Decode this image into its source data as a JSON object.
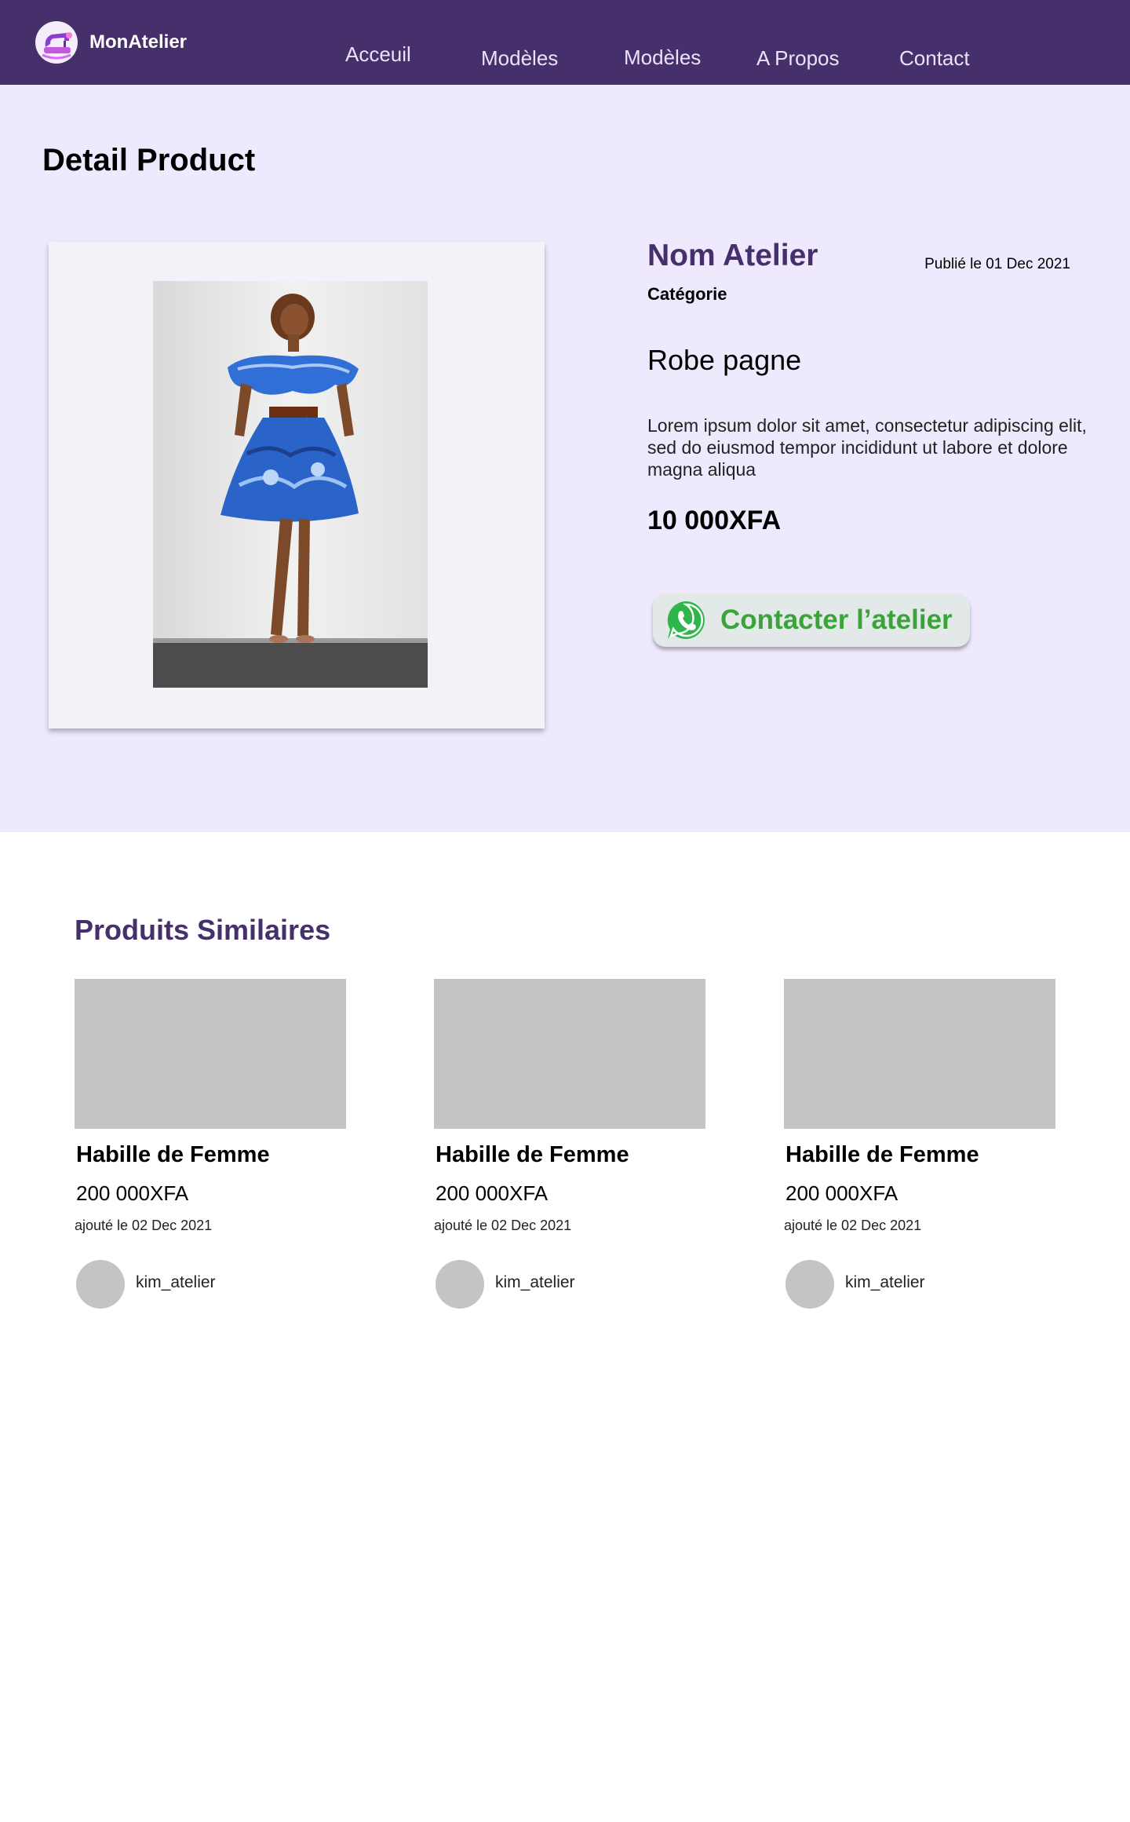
{
  "brand": {
    "name": "MonAtelier",
    "accent": "#45306b",
    "logo_icon": "sewing-machine-icon"
  },
  "nav": {
    "items": [
      {
        "label": "Acceuil"
      },
      {
        "label": "Modèles"
      },
      {
        "label": "Modèles"
      },
      {
        "label": "A Propos"
      },
      {
        "label": "Contact"
      }
    ]
  },
  "detail": {
    "page_title": "Detail Product",
    "atelier_name": "Nom Atelier",
    "published": "Publié le 01 Dec 2021",
    "category": "Catégorie",
    "product_name": "Robe pagne",
    "description": "Lorem ipsum dolor sit amet, consectetur adipiscing elit, sed do eiusmod tempor incididunt ut labore et dolore magna aliqua",
    "price": "10 000XFA",
    "contact_button": {
      "label": "Contacter l’atelier",
      "icon": "whatsapp-icon",
      "color": "#3aa43a"
    }
  },
  "similar": {
    "title": "Produits Similaires",
    "products": [
      {
        "title": "Habille de Femme",
        "price": "200 000XFA",
        "date": "ajouté le 02 Dec 2021",
        "user": "kim_atelier"
      },
      {
        "title": "Habille de Femme",
        "price": "200 000XFA",
        "date": "ajouté le 02 Dec 2021",
        "user": "kim_atelier"
      },
      {
        "title": "Habille de Femme",
        "price": "200 000XFA",
        "date": "ajouté le 02 Dec 2021",
        "user": "kim_atelier"
      }
    ]
  }
}
